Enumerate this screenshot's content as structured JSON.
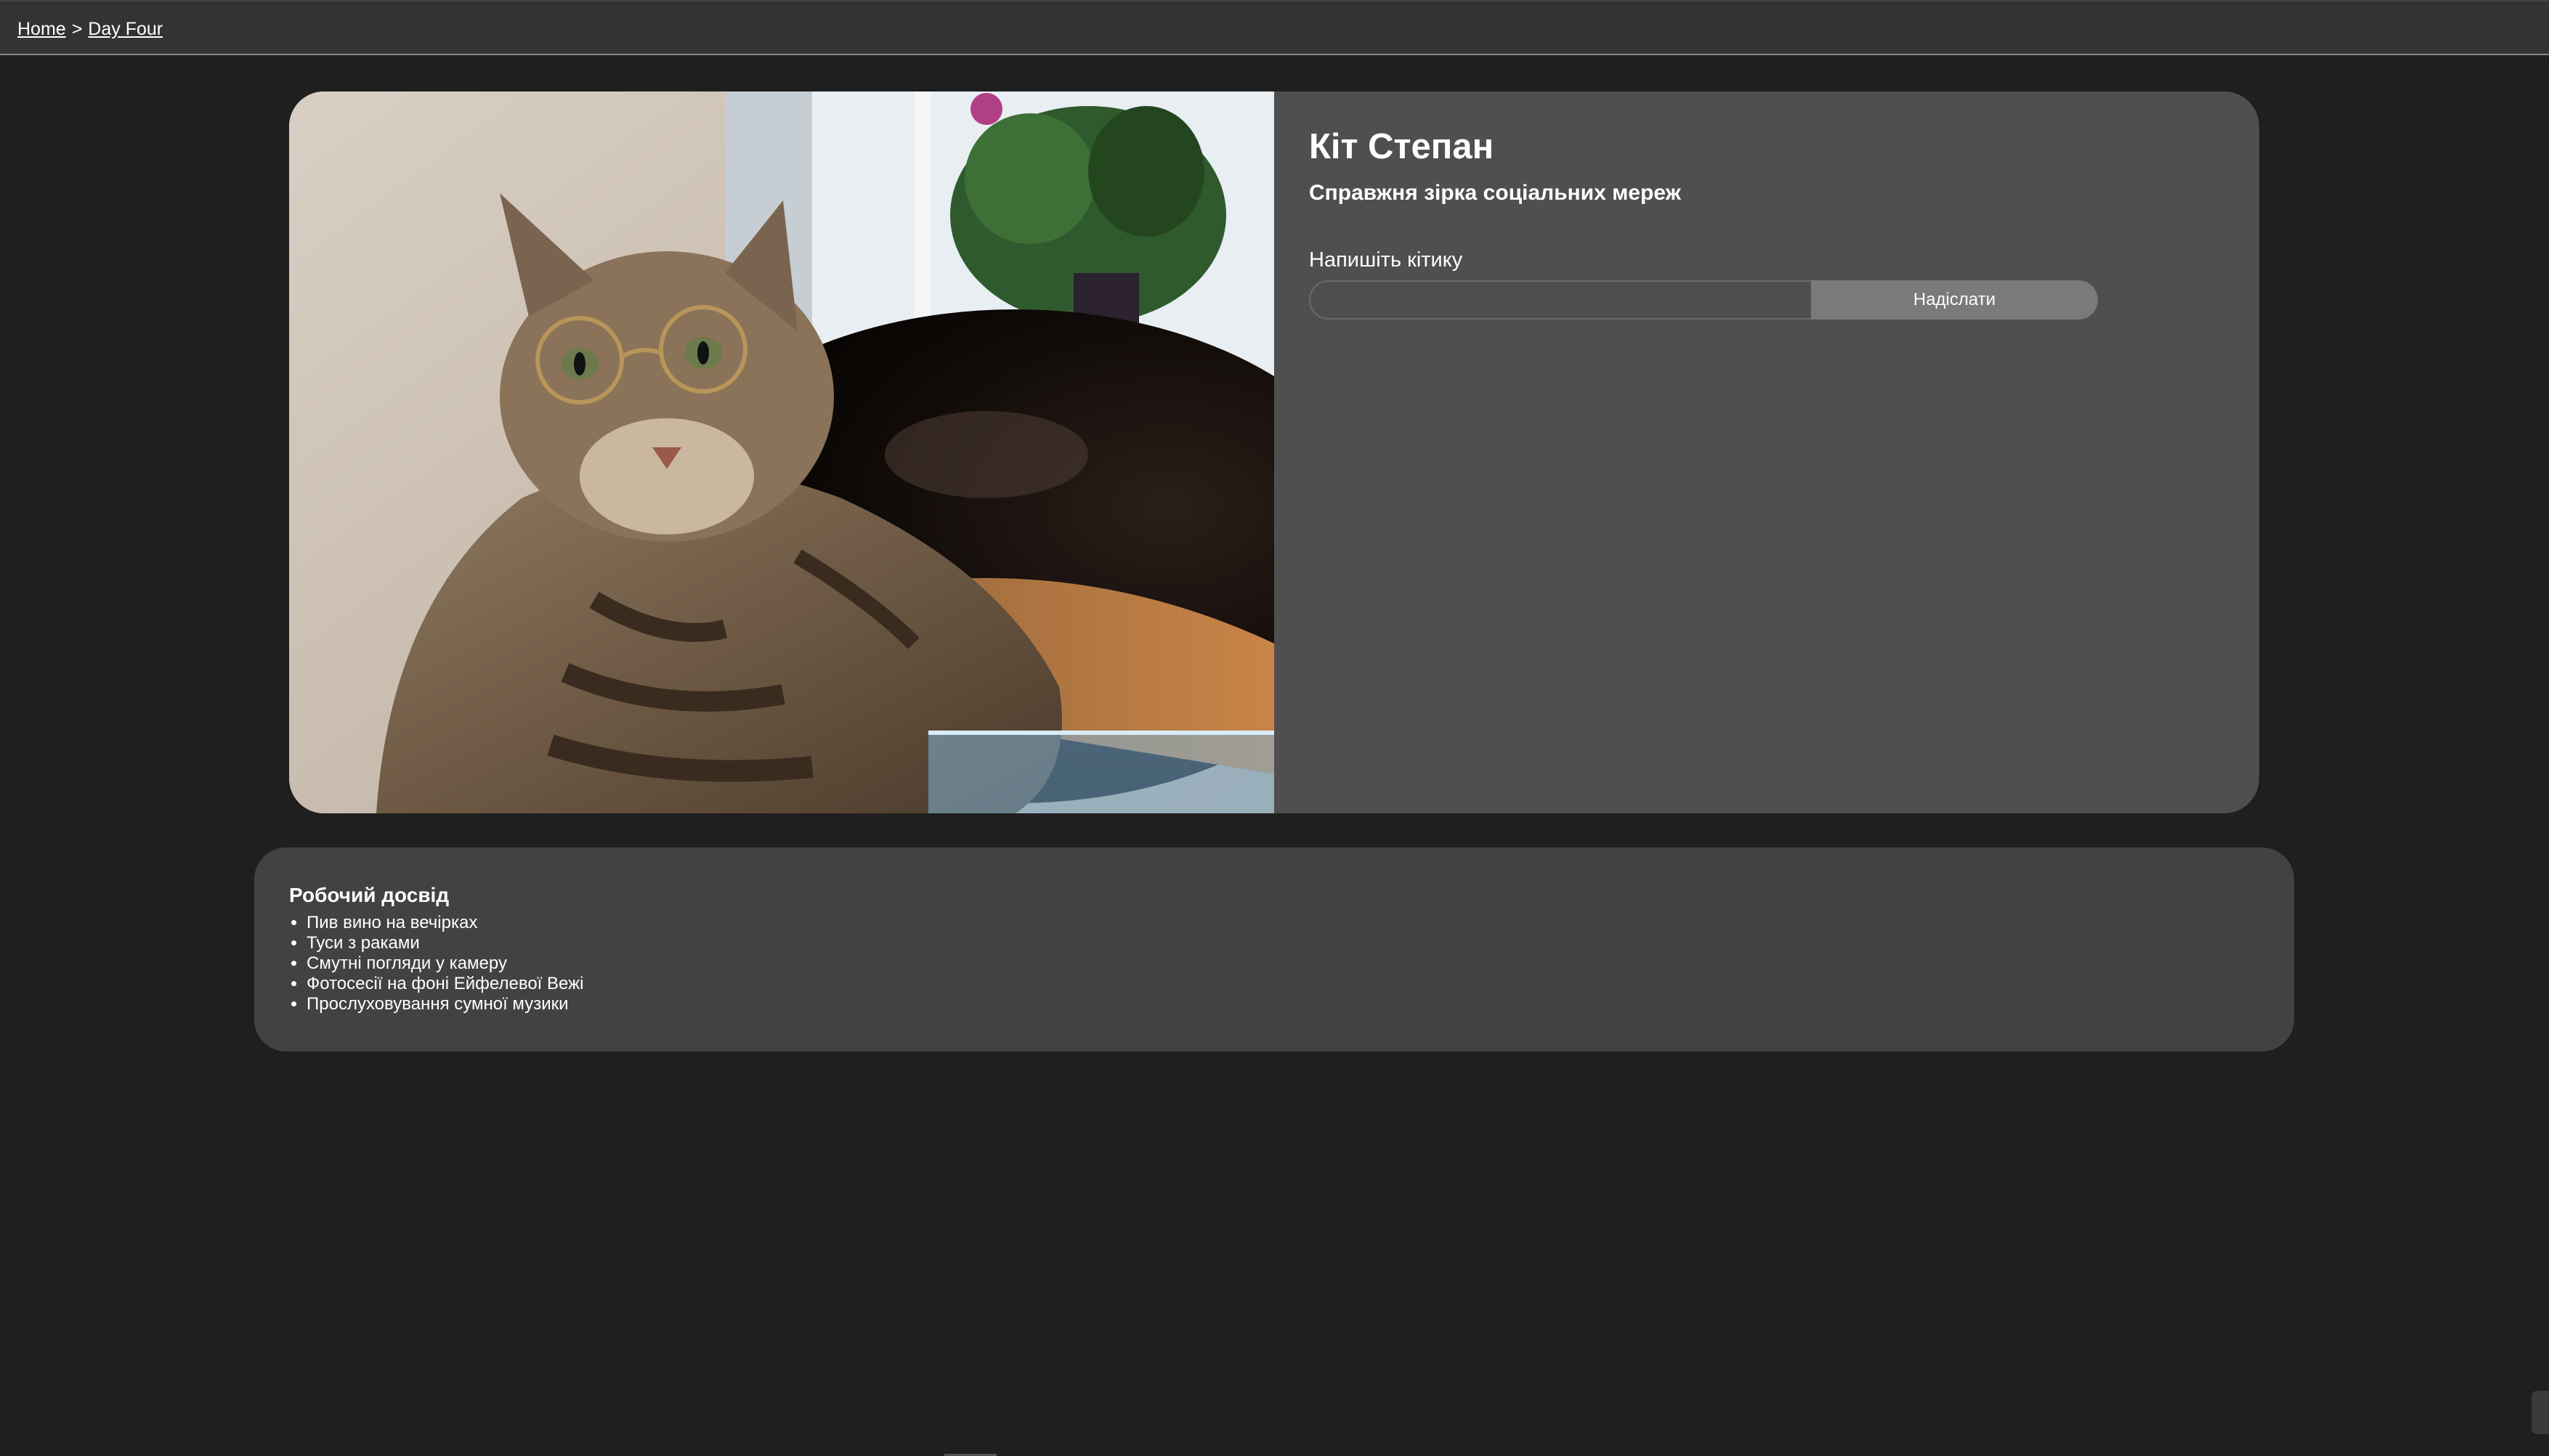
{
  "breadcrumb": {
    "home": "Home",
    "separator": ">",
    "current": "Day Four"
  },
  "profile": {
    "photo_icon": "cat-photo",
    "name": "Кіт Степан",
    "tagline": "Справжня зірка соціальних мереж",
    "message_label": "Напишіть кітику",
    "message_value": "",
    "send_label": "Надіслати"
  },
  "experience": {
    "title": "Робочий досвід",
    "items": [
      "Пив вино на вечірках",
      "Туси з раками",
      "Смутні погляди у камеру",
      "Фотосесії на фоні Ейфелевої Вежі",
      "Прослуховування сумної музики"
    ]
  },
  "colors": {
    "page_background": "#1f1f1f",
    "topbar": "#333333",
    "profile_card": "#4f4f4f",
    "experience_card": "#424242",
    "button": "#7a7a7a",
    "text": "#ffffff"
  }
}
